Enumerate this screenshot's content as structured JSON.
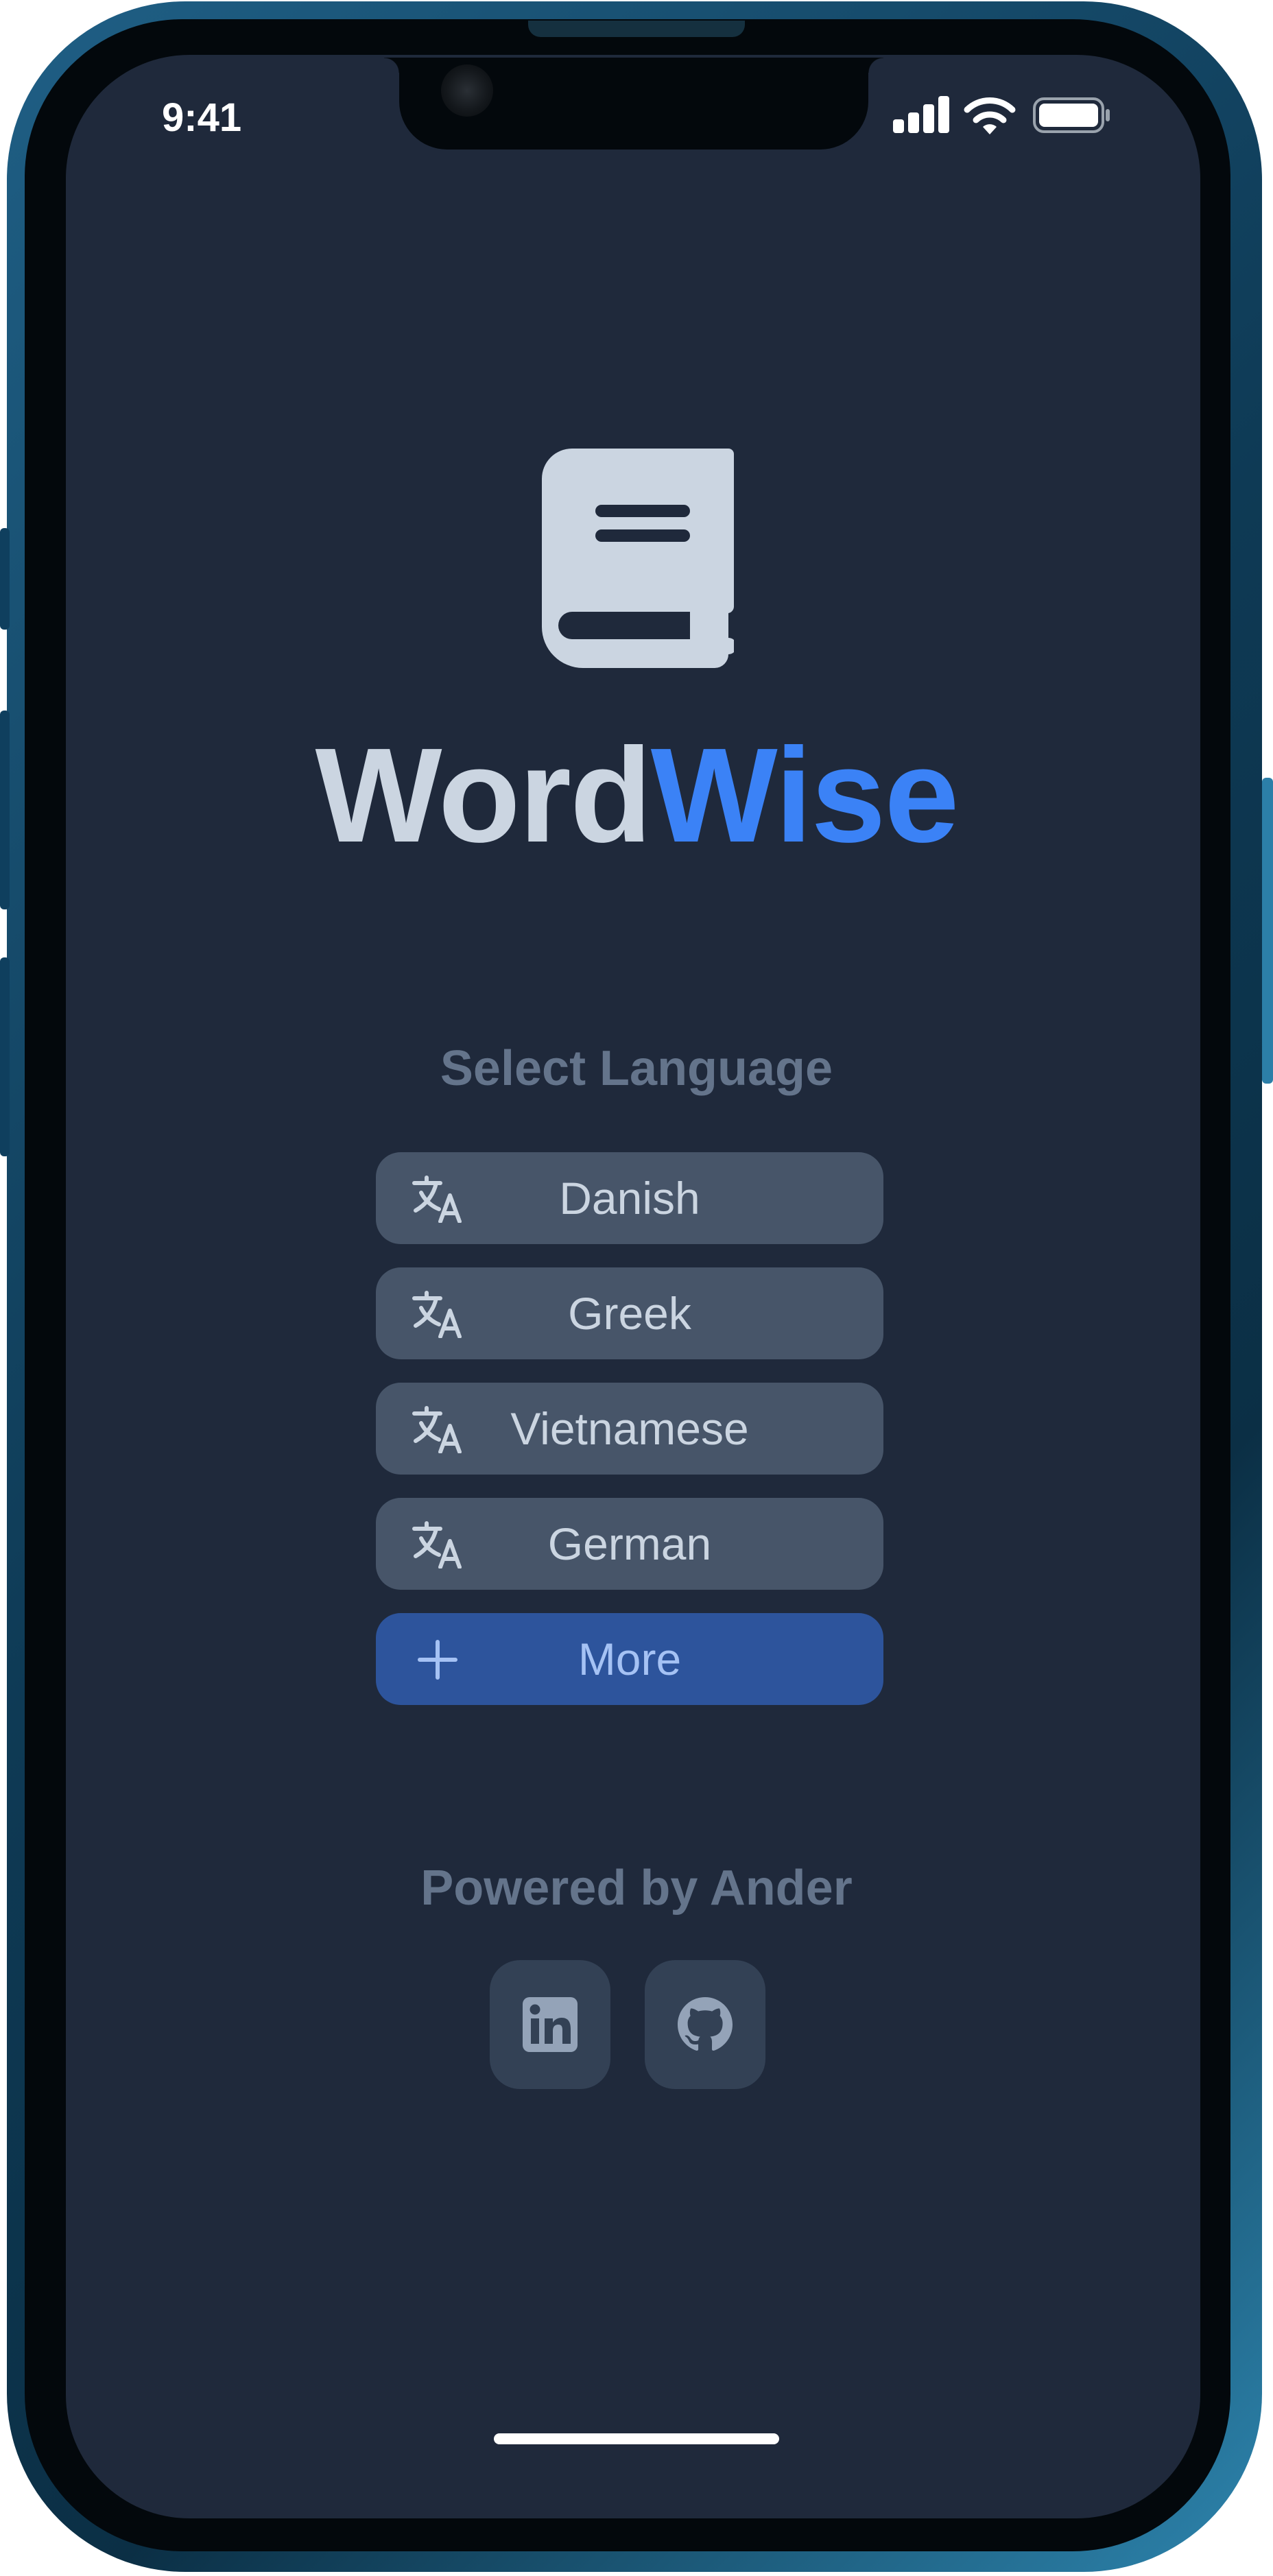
{
  "status_bar": {
    "time": "9:41"
  },
  "app": {
    "title_part1": "Word",
    "title_part2": "Wise",
    "title_color_1": "#cbd5e1",
    "title_color_2": "#3b82f6"
  },
  "language_section": {
    "heading": "Select Language",
    "languages": [
      {
        "label": "Danish",
        "icon": "translate-icon"
      },
      {
        "label": "Greek",
        "icon": "translate-icon"
      },
      {
        "label": "Vietnamese",
        "icon": "translate-icon"
      },
      {
        "label": "German",
        "icon": "translate-icon"
      }
    ],
    "more": {
      "label": "More",
      "icon": "plus-icon"
    }
  },
  "footer": {
    "powered_by": "Powered by Ander",
    "links": [
      {
        "name": "linkedin",
        "icon": "linkedin-icon"
      },
      {
        "name": "github",
        "icon": "github-icon"
      }
    ]
  },
  "colors": {
    "screen_bg": "#1f293b",
    "button_bg": "#475569",
    "more_bg": "#2d549c",
    "muted_text": "#64748b"
  }
}
